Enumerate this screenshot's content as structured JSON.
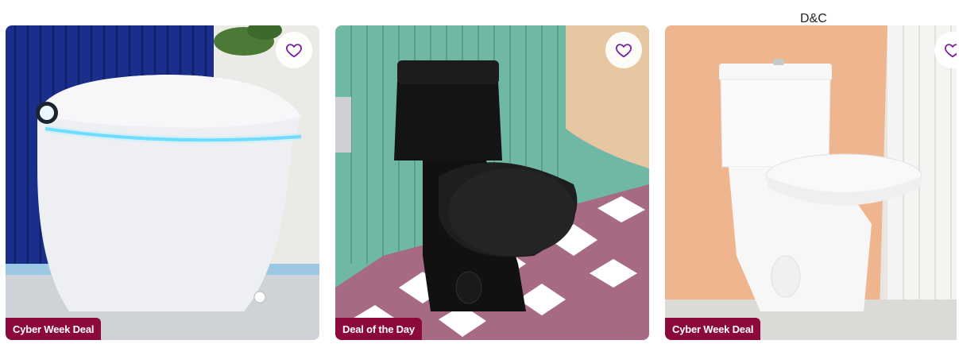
{
  "brand": {
    "label": "D&C"
  },
  "colors": {
    "badge": "#8b0a3b",
    "heart": "#7b1fa2",
    "glow": "#4fd2ff"
  },
  "products": [
    {
      "badge": "Cyber Week Deal",
      "image_alt": "White smart toilet with blue glowing rim",
      "favorite_icon": "heart-outline-icon"
    },
    {
      "badge": "Deal of the Day",
      "image_alt": "Black one-piece toilet on patterned tile",
      "favorite_icon": "heart-outline-icon"
    },
    {
      "badge": "Cyber Week Deal",
      "image_alt": "White one-piece toilet by peach wall",
      "favorite_icon": "heart-outline-icon"
    }
  ]
}
